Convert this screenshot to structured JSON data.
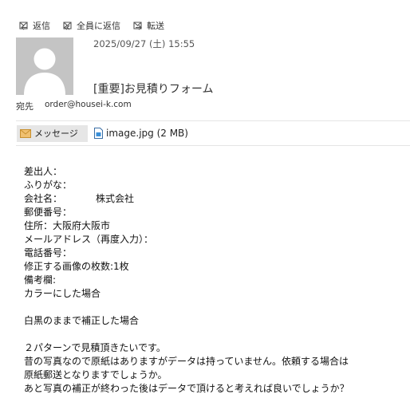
{
  "toolbar": {
    "reply": "返信",
    "reply_all": "全員に返信",
    "forward": "転送"
  },
  "header": {
    "date": "2025/09/27 (土) 15:55",
    "subject": "[重要]お見積りフォーム",
    "to_label": "宛先",
    "to_address": "order@housei-k.com"
  },
  "tabs": {
    "message": "メッセージ",
    "attachment": "image.jpg (2 MB)"
  },
  "body": {
    "lines": [
      "差出人：",
      "ふりがな：",
      "会社名：　　　　株式会社",
      "郵便番号：",
      "住所：大阪府大阪市",
      "メールアドレス（再度入力）：",
      "電話番号：",
      "修正する画像の枚数:1枚",
      "備考欄:",
      "カラーにした場合",
      "",
      "白黒のままで補正した場合",
      "",
      "２パターンで見積頂きたいです。",
      "昔の写真なので原紙はありますがデータは持っていません。依頼する場合は",
      "原紙郵送となりますでしょうか。",
      "あと写真の補正が終わった後はデータで頂けると考えれば良いでしょうか？"
    ]
  }
}
